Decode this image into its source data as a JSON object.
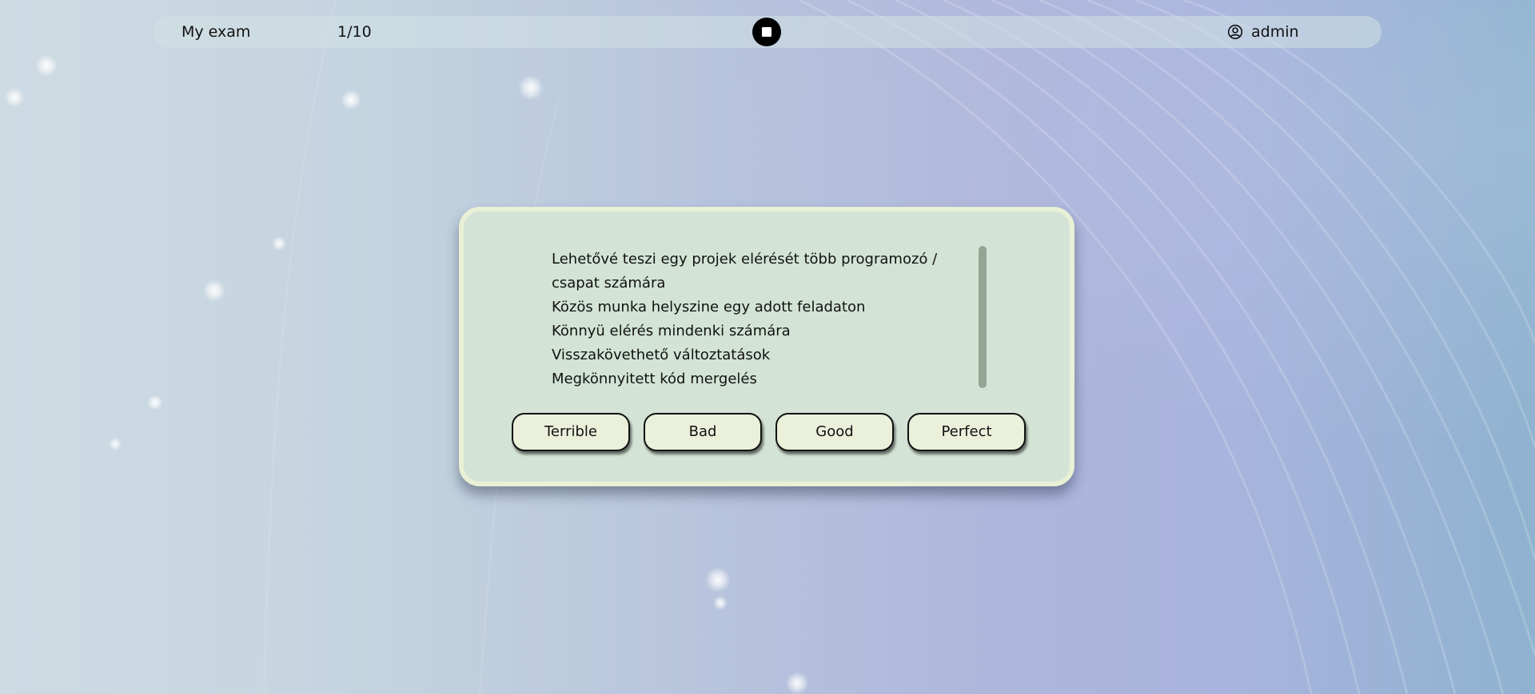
{
  "header": {
    "exam_title": "My exam",
    "progress": "1/10",
    "stop_icon": "stop-icon",
    "user_icon": "user-circle-icon",
    "user_name": "admin"
  },
  "card": {
    "answer_lines": [
      "Lehetővé teszi egy projek elérését több programozó /",
      "csapat számára",
      "Közös munka helyszine egy adott feladaton",
      "Könnyü elérés mindenki számára",
      "Visszakövethető változtatások",
      "Megkönnyitett kód mergelés"
    ],
    "ratings": [
      "Terrible",
      "Bad",
      "Good",
      "Perfect"
    ]
  },
  "colors": {
    "card_bg": "#d3e4d6",
    "card_border": "#e8f0d6",
    "button_bg": "#ebf0db",
    "scrollbar": "#95a595"
  }
}
